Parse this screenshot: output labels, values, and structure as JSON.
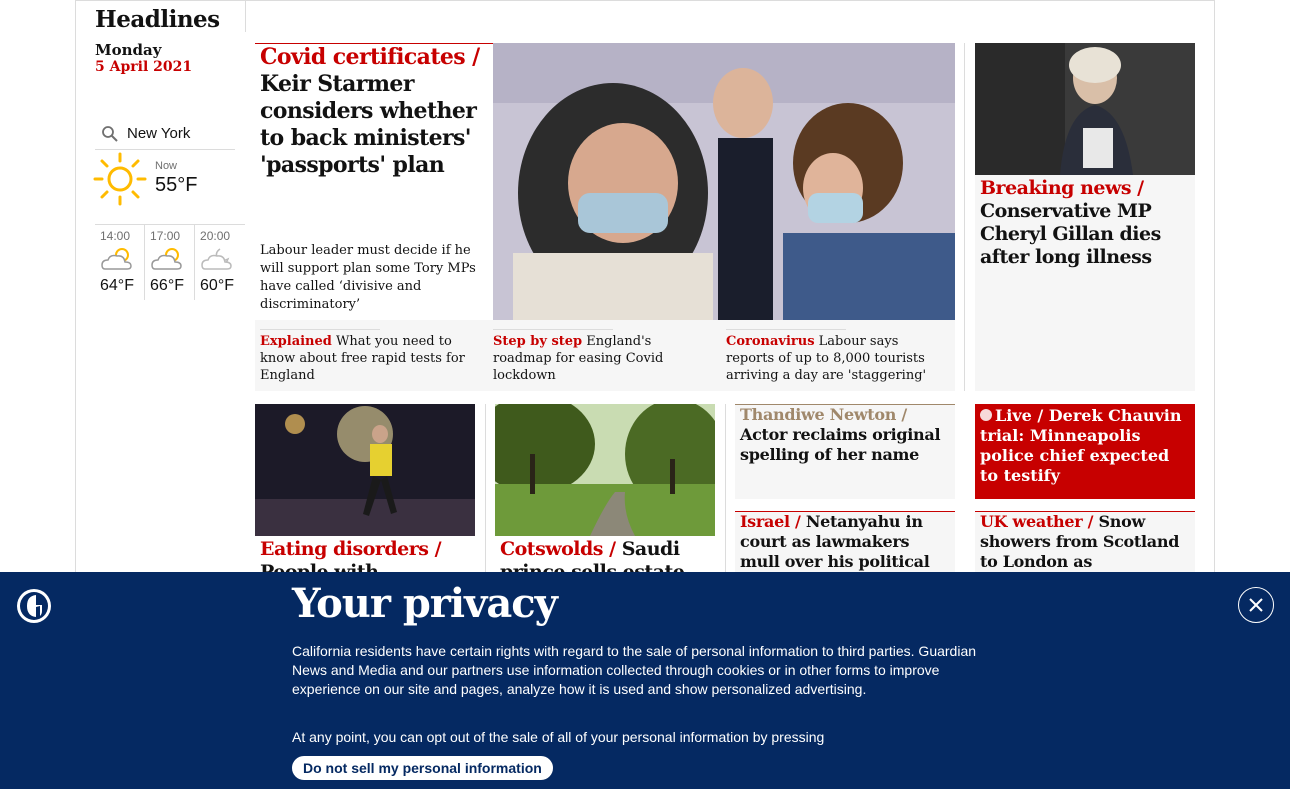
{
  "sidebar": {
    "title": "Headlines",
    "day": "Monday",
    "date": "5 April 2021",
    "location": "New York",
    "now_label": "Now",
    "now_temp": "55°F",
    "forecast": [
      {
        "time": "14:00",
        "temp": "64°F"
      },
      {
        "time": "17:00",
        "temp": "66°F"
      },
      {
        "time": "20:00",
        "temp": "60°F"
      }
    ]
  },
  "main": {
    "kicker": "Covid certificates /",
    "headline": "Keir Starmer considers whether to back ministers' 'passports' plan",
    "standfirst": "Labour leader must decide if he will support plan some Tory MPs have called ‘divisive and discriminatory’",
    "sublinks": [
      {
        "kicker": "Explained",
        "text": "What you need to know about free rapid tests for England"
      },
      {
        "kicker": "Step by step",
        "text": "England's roadmap for easing Covid lockdown"
      },
      {
        "kicker": "Coronavirus",
        "text": "Labour says reports of up to 8,000 tourists arriving a day are 'staggering'"
      }
    ]
  },
  "side": {
    "kicker": "Breaking news /",
    "headline": "Conservative MP Cheryl Gillan dies after long illness"
  },
  "row2": {
    "eating_kicker": "Eating disorders /",
    "eating_headline": "People with condition",
    "cotswolds_kicker": "Cotswolds /",
    "cotswolds_headline": "Saudi prince sells estate to",
    "thandiwe_kicker": "Thandiwe Newton /",
    "thandiwe_headline": "Actor reclaims original spelling of her name",
    "live_label": "Live /",
    "live_headline": "Derek Chauvin trial: Minneapolis police chief expected to testify",
    "israel_kicker": "Israel /",
    "israel_headline": "Netanyahu in court as lawmakers mull over his political fate",
    "weather_kicker": "UK weather /",
    "weather_headline": "Snow showers from Scotland to London as temperatures"
  },
  "banner": {
    "title": "Your privacy",
    "paragraph1": "California residents have certain rights with regard to the sale of personal information to third parties. Guardian News and Media and our partners use information collected through cookies or in other forms to improve experience on our site and pages, analyze how it is used and show personalized advertising.",
    "paragraph2": "At any point, you can opt out of the sale of all of your personal information by pressing",
    "button": "Do not sell my personal information"
  },
  "colors": {
    "red": "#c70000",
    "navy": "#052962",
    "brown": "#a0886b"
  }
}
